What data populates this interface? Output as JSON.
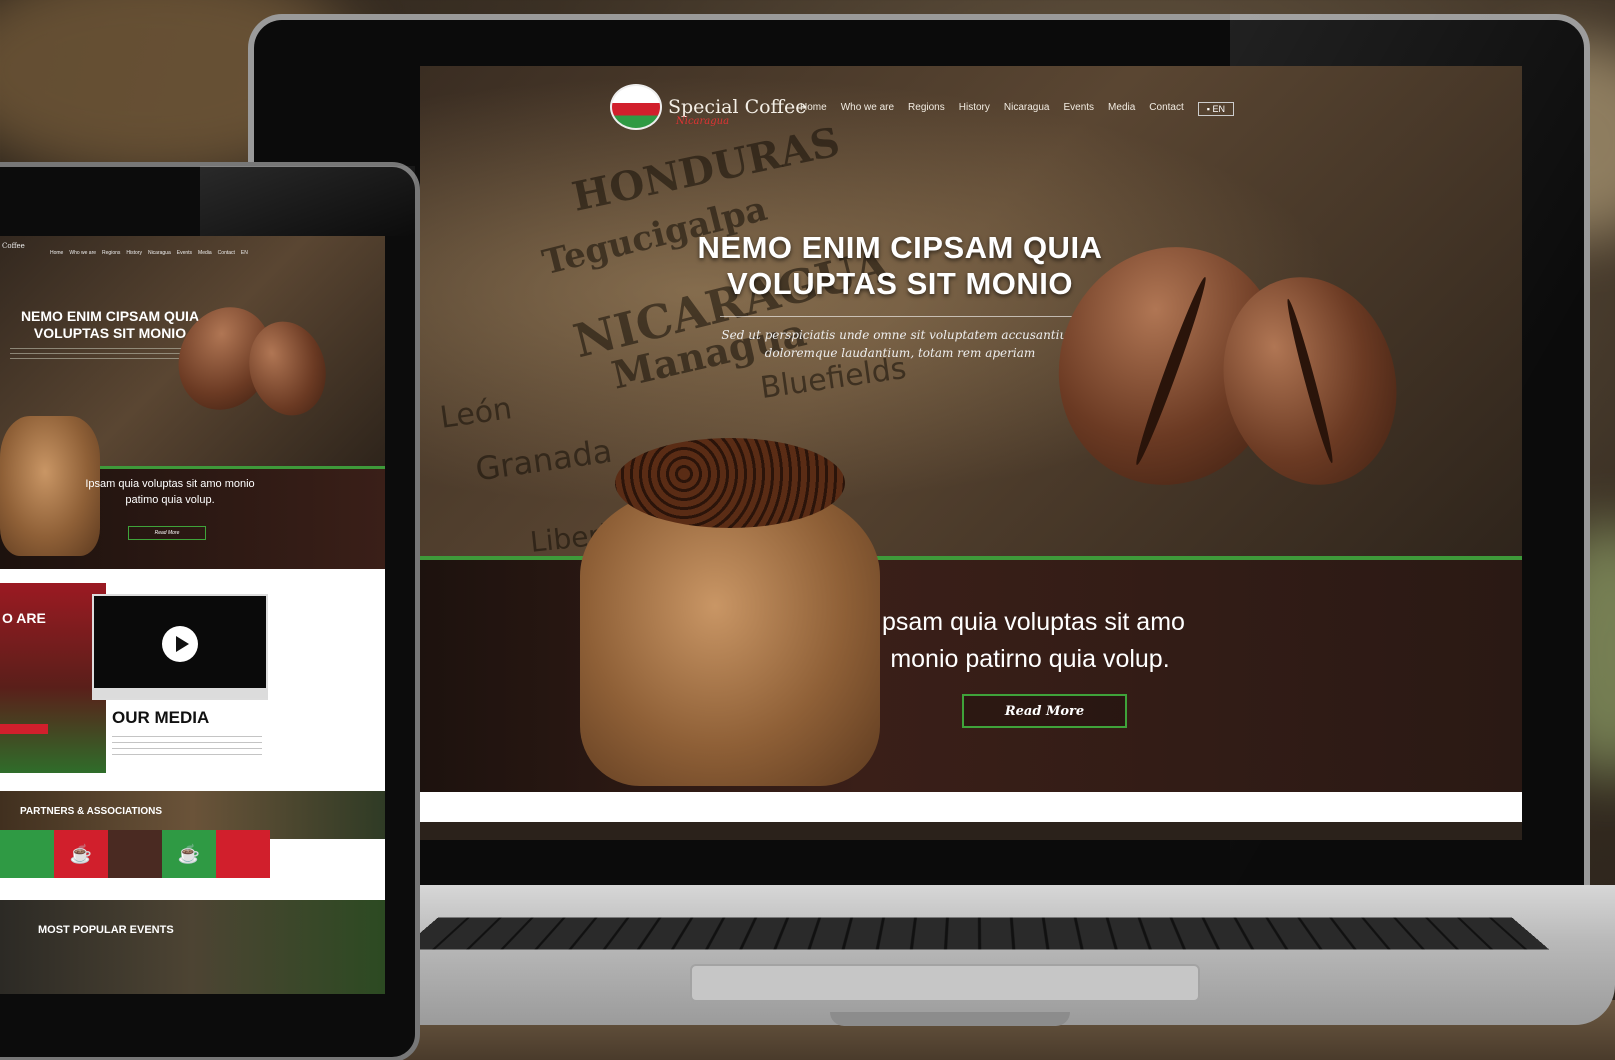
{
  "laptop_site": {
    "logo": {
      "name": "Special Coffee",
      "sub": "Nicaragua"
    },
    "nav": [
      "Home",
      "Who we are",
      "Regions",
      "History",
      "Nicaragua",
      "Events",
      "Media",
      "Contact"
    ],
    "lang": "EN",
    "hero_title": "NEMO ENIM CIPSAM QUIA VOLUPTAS SIT MONIO",
    "hero_subtitle": "Sed ut perspiciatis unde omne sit voluptatem accusantium doloremque laudantium, totam rem aperiam",
    "map_words": [
      "HONDURAS",
      "Tegucigalpa",
      "NICARAGUA",
      "Managua",
      "Bluefields",
      "Granada",
      "León",
      "Liberia"
    ],
    "section_text": "Ipsam quia voluptas sit amo monio patirno quia volup.",
    "read_more": "Read More"
  },
  "tablet_site": {
    "logo": "Coffee",
    "nav": [
      "Home",
      "Who we are",
      "Regions",
      "History",
      "Nicaragua",
      "Events",
      "Media",
      "Contact",
      "EN"
    ],
    "hero_title": "NEMO ENIM CIPSAM QUIA VOLUPTAS SIT MONIO",
    "section_text": "Ipsam quia voluptas sit amo monio patimo quia volup.",
    "read_more": "Read More",
    "who_text": "O ARE",
    "media_title": "OUR MEDIA",
    "partners_title": "PARTNERS & ASSOCIATIONS",
    "events_title": "MOST POPULAR EVENTS"
  },
  "colors": {
    "accent_green": "#3e9a3a",
    "accent_red": "#d11f2c",
    "bg_dark": "#2b221b"
  },
  "icons": [
    "play-icon",
    "flag-icon"
  ]
}
